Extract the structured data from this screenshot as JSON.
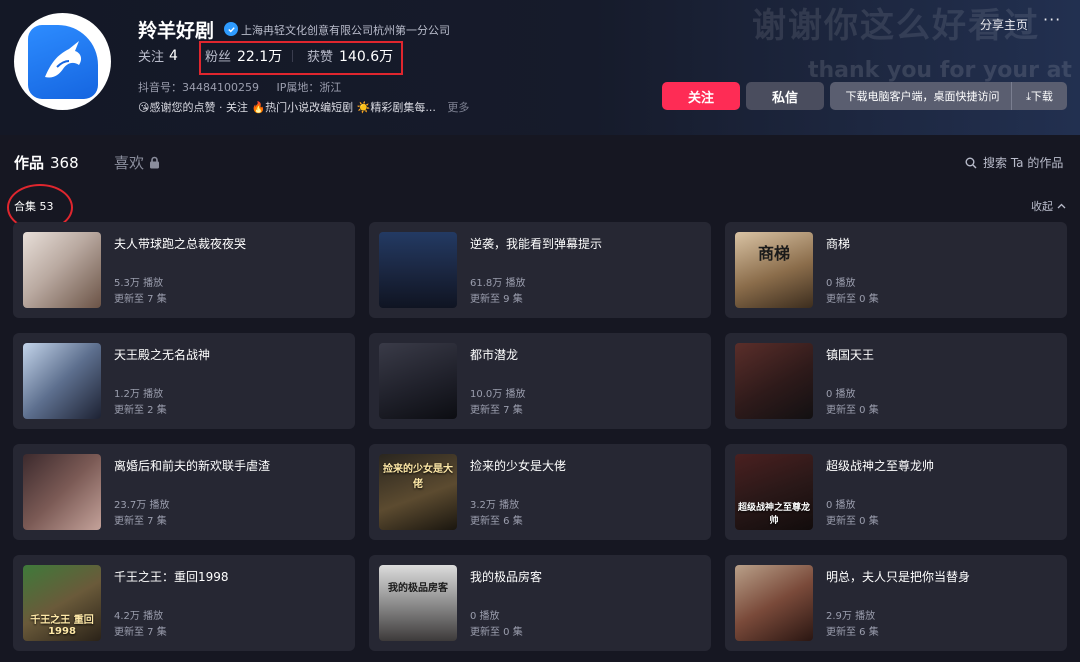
{
  "profile": {
    "name": "羚羊好剧",
    "company": "上海冉轻文化创意有限公司杭州第一分公司",
    "following_label": "关注",
    "following_count": "4",
    "fans_label": "粉丝",
    "fans_count": "22.1万",
    "likes_label": "获赞",
    "likes_count": "140.6万",
    "douyin_id": "抖音号：34484100259",
    "ip_location": "IP属地：浙江",
    "tags": "😘感谢您的点赞 · 关注 🔥热门小说改编短剧 ☀️精彩剧集每...",
    "more": "更多"
  },
  "banner": {
    "line1": "谢谢你这么好看过",
    "line2": "thank you for your at"
  },
  "actions": {
    "share": "分享主页",
    "more_dots": "···",
    "follow": "关注",
    "message": "私信",
    "download_text": "下载电脑客户端，桌面快捷访问",
    "download_btn": "⤓下载"
  },
  "tabs": {
    "works_label": "作品",
    "works_count": "368",
    "likes_label": "喜欢",
    "search": "搜索 Ta 的作品"
  },
  "collection": {
    "label": "合集 53",
    "collapse": "收起"
  },
  "cards": [
    {
      "title": "夫人带球跑之总裁夜夜哭",
      "plays": "5.3万 播放",
      "updated": "更新至 7 集",
      "overlay": ""
    },
    {
      "title": "逆袭，我能看到弹幕提示",
      "plays": "61.8万 播放",
      "updated": "更新至 9 集",
      "overlay": ""
    },
    {
      "title": "商梯",
      "plays": "0 播放",
      "updated": "更新至 0 集",
      "overlay": "商梯"
    },
    {
      "title": "天王殿之无名战神",
      "plays": "1.2万 播放",
      "updated": "更新至 2 集",
      "overlay": ""
    },
    {
      "title": "都市潜龙",
      "plays": "10.0万 播放",
      "updated": "更新至 7 集",
      "overlay": ""
    },
    {
      "title": "镇国天王",
      "plays": "0 播放",
      "updated": "更新至 0 集",
      "overlay": ""
    },
    {
      "title": "离婚后和前夫的新欢联手虐渣",
      "plays": "23.7万 播放",
      "updated": "更新至 7 集",
      "overlay": ""
    },
    {
      "title": "捡来的少女是大佬",
      "plays": "3.2万 播放",
      "updated": "更新至 6 集",
      "overlay": "捡来的少女是大佬"
    },
    {
      "title": "超级战神之至尊龙帅",
      "plays": "0 播放",
      "updated": "更新至 0 集",
      "overlay": "超级战神之至尊龙帅"
    },
    {
      "title": "千王之王：重回1998",
      "plays": "4.2万 播放",
      "updated": "更新至 7 集",
      "overlay": "千王之王 重回1998"
    },
    {
      "title": "我的极品房客",
      "plays": "0 播放",
      "updated": "更新至 0 集",
      "overlay": "我的极品房客"
    },
    {
      "title": "明总，夫人只是把你当替身",
      "plays": "2.9万 播放",
      "updated": "更新至 6 集",
      "overlay": ""
    }
  ],
  "colors": {
    "accent": "#fe2c55",
    "highlight": "#e0262e",
    "card": "#262733",
    "background": "#161722"
  }
}
